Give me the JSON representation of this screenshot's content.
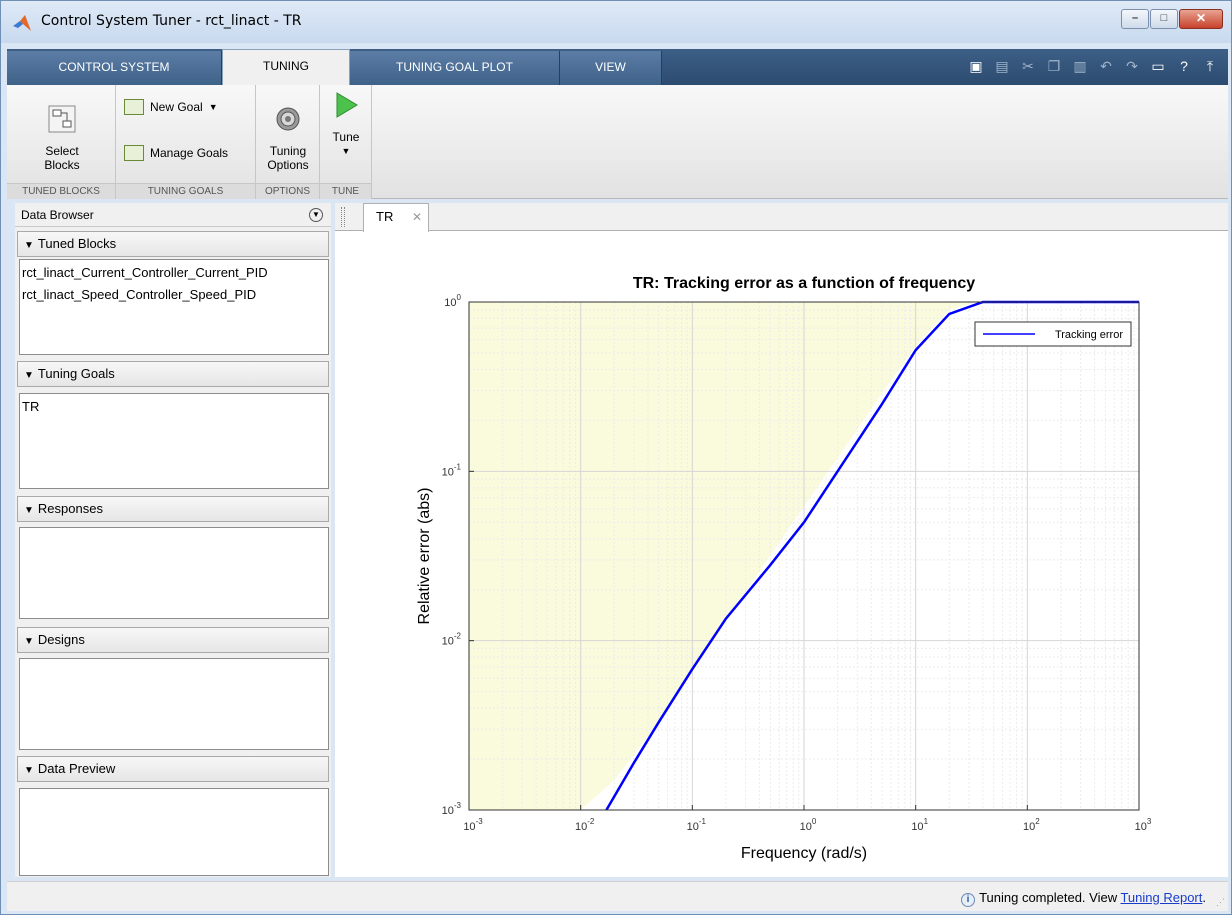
{
  "window": {
    "title": "Control System Tuner - rct_linact - TR",
    "buttons": {
      "minimize": "–",
      "maximize": "□",
      "close": "✕"
    }
  },
  "tabs": [
    {
      "label": "CONTROL SYSTEM",
      "active": false
    },
    {
      "label": "TUNING",
      "active": true
    },
    {
      "label": "TUNING GOAL PLOT",
      "active": false
    },
    {
      "label": "VIEW",
      "active": false
    }
  ],
  "ribbon": {
    "tuned_blocks": {
      "label": "TUNED BLOCKS",
      "select_blocks": "Select\nBlocks"
    },
    "tuning_goals": {
      "label": "TUNING GOALS",
      "new_goal": "New Goal",
      "manage_goals": "Manage Goals"
    },
    "options": {
      "label": "OPTIONS",
      "tuning_options": "Tuning\nOptions"
    },
    "tune": {
      "label": "TUNE",
      "tune": "Tune"
    }
  },
  "data_browser": {
    "title": "Data Browser",
    "sections": {
      "tuned_blocks": {
        "label": "Tuned Blocks",
        "items": [
          "rct_linact_Current_Controller_Current_PID",
          "rct_linact_Speed_Controller_Speed_PID"
        ]
      },
      "tuning_goals": {
        "label": "Tuning Goals",
        "items": [
          "TR"
        ]
      },
      "responses": {
        "label": "Responses",
        "items": []
      },
      "designs": {
        "label": "Designs",
        "items": []
      },
      "data_preview": {
        "label": "Data Preview",
        "items": []
      }
    }
  },
  "document": {
    "tab_label": "TR"
  },
  "status": {
    "text": "Tuning completed. View ",
    "link": "Tuning Report",
    "suffix": "."
  },
  "colors": {
    "curve": "#0000ff",
    "bound_fill": "#fafadc",
    "accent": "#2c4b70"
  },
  "chart_data": {
    "type": "line",
    "title": "TR: Tracking error as a function of frequency",
    "xlabel": "Frequency (rad/s)",
    "ylabel": "Relative error (abs)",
    "xscale": "log",
    "yscale": "log",
    "xlim": [
      0.001,
      1000
    ],
    "ylim": [
      0.001,
      1
    ],
    "x_ticks": [
      "10^-3",
      "10^-2",
      "10^-1",
      "10^0",
      "10^1",
      "10^2",
      "10^3"
    ],
    "y_ticks": [
      "10^-3",
      "10^-2",
      "10^-1",
      "10^0"
    ],
    "grid": true,
    "legend_position": "top-right",
    "series": [
      {
        "name": "Tracking error",
        "x": [
          0.017,
          0.03,
          0.05,
          0.1,
          0.2,
          0.5,
          1,
          2,
          5,
          10,
          20,
          40,
          100,
          1000
        ],
        "y": [
          0.001,
          0.0019,
          0.0033,
          0.0068,
          0.0135,
          0.028,
          0.05,
          0.1,
          0.25,
          0.52,
          0.85,
          1.0,
          1.0,
          1.0
        ]
      }
    ],
    "bound": {
      "x": [
        0.001,
        0.01,
        0.02,
        0.05,
        0.1,
        0.2,
        0.5,
        1,
        2,
        5,
        10,
        20,
        35,
        1000
      ],
      "y": [
        0.001,
        0.001,
        0.0015,
        0.0033,
        0.0065,
        0.013,
        0.032,
        0.062,
        0.12,
        0.29,
        0.55,
        0.9,
        1.0,
        1.0
      ]
    }
  }
}
